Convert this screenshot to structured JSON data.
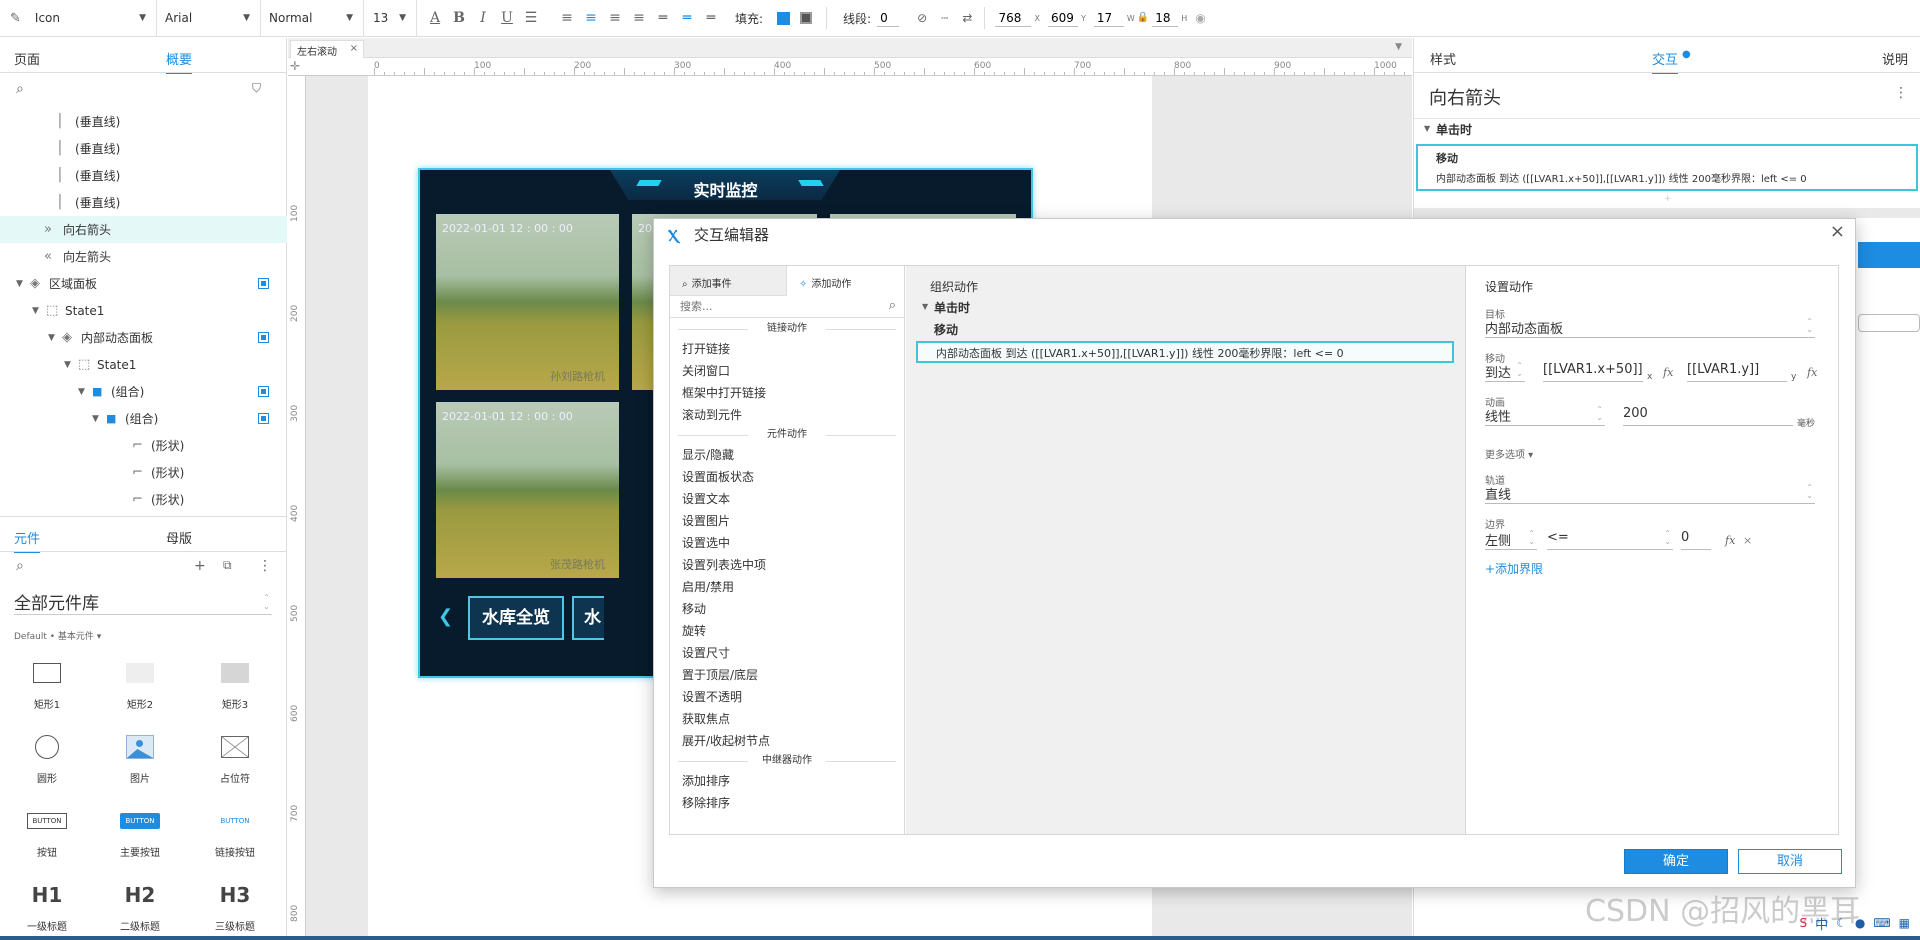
{
  "toolbar": {
    "style_select": "Icon",
    "font_select": "Arial",
    "weight_select": "Normal",
    "size_select": "13",
    "fill_label": "填充:",
    "line_label": "线段:",
    "line_value": "0",
    "x": "768",
    "x_label": "X",
    "y": "609",
    "y_label": "Y",
    "w": "17",
    "w_label": "W",
    "h": "18",
    "h_label": "H",
    "fill_color": "#1e8ce0"
  },
  "left": {
    "tab_pages": "页面",
    "tab_outline": "概要",
    "outline": [
      {
        "label": "(垂直线)",
        "indent": 56,
        "icon": "line"
      },
      {
        "label": "(垂直线)",
        "indent": 56,
        "icon": "line"
      },
      {
        "label": "(垂直线)",
        "indent": 56,
        "icon": "line"
      },
      {
        "label": "(垂直线)",
        "indent": 56,
        "icon": "line"
      },
      {
        "label": "向右箭头",
        "indent": 44,
        "icon": "chev-right",
        "selected": true
      },
      {
        "label": "向左箭头",
        "indent": 44,
        "icon": "chev-left"
      },
      {
        "label": "区域面板",
        "indent": 30,
        "icon": "stack",
        "arrow": true,
        "check": true
      },
      {
        "label": "State1",
        "indent": 46,
        "icon": "state",
        "arrow": true
      },
      {
        "label": "内部动态面板",
        "indent": 62,
        "icon": "stack",
        "arrow": true,
        "check": true
      },
      {
        "label": "State1",
        "indent": 78,
        "icon": "state",
        "arrow": true
      },
      {
        "label": "(组合)",
        "indent": 92,
        "icon": "folder",
        "arrow": true,
        "check": true
      },
      {
        "label": "(组合)",
        "indent": 106,
        "icon": "folder",
        "arrow": true,
        "check": true
      },
      {
        "label": "(形状)",
        "indent": 132,
        "icon": "shape"
      },
      {
        "label": "(形状)",
        "indent": 132,
        "icon": "shape"
      },
      {
        "label": "(形状)",
        "indent": 132,
        "icon": "shape"
      }
    ],
    "tab_widgets": "元件",
    "tab_masters": "母版",
    "library_select": "全部元件库",
    "library_sub": "Default • 基本元件 ▾",
    "widgets": [
      {
        "label": "矩形1",
        "kind": "rect1"
      },
      {
        "label": "矩形2",
        "kind": "rect2"
      },
      {
        "label": "矩形3",
        "kind": "rect3"
      },
      {
        "label": "圆形",
        "kind": "circle"
      },
      {
        "label": "图片",
        "kind": "image"
      },
      {
        "label": "占位符",
        "kind": "placeholder"
      },
      {
        "label": "按钮",
        "kind": "button",
        "text": "BUTTON"
      },
      {
        "label": "主要按钮",
        "kind": "primary",
        "text": "BUTTON"
      },
      {
        "label": "链接按钮",
        "kind": "link",
        "text": "BUTTON"
      },
      {
        "label": "一级标题",
        "kind": "h",
        "text": "H1"
      },
      {
        "label": "二级标题",
        "kind": "h",
        "text": "H2"
      },
      {
        "label": "三级标题",
        "kind": "h",
        "text": "H3"
      }
    ]
  },
  "canvas": {
    "tab": "左右滚动",
    "ruler_h": [
      "0",
      "100",
      "200",
      "300",
      "400",
      "500",
      "600",
      "700",
      "800",
      "900",
      "1000"
    ],
    "ruler_v": [
      "100",
      "200",
      "300",
      "400",
      "500",
      "600",
      "700",
      "800"
    ],
    "monitor_title": "实时监控",
    "timestamp": "2022-01-01  12 : 00 : 00",
    "cam_labels": [
      "孙刘路枪机",
      "张茂路枪机"
    ],
    "btn1": "水库全览",
    "btn2": "水"
  },
  "right": {
    "tab_style": "样式",
    "tab_interact": "交互",
    "tab_notes": "说明",
    "title": "向右箭头",
    "event": "单击时",
    "action_title": "移动",
    "action_desc": "内部动态面板 到达 ([[LVAR1.x+50]],[[LVAR1.y]]) 线性 200毫秒界限：left <= 0"
  },
  "dialog": {
    "title": "交互编辑器",
    "tab_add_event": "添加事件",
    "tab_add_action": "添加动作",
    "search_placeholder": "搜索...",
    "groups": [
      {
        "title": "链接动作",
        "items": [
          "打开链接",
          "关闭窗口",
          "框架中打开链接",
          "滚动到元件"
        ]
      },
      {
        "title": "元件动作",
        "items": [
          "显示/隐藏",
          "设置面板状态",
          "设置文本",
          "设置图片",
          "设置选中",
          "设置列表选中项",
          "启用/禁用",
          "移动",
          "旋转",
          "设置尺寸",
          "置于顶层/底层",
          "设置不透明",
          "获取焦点",
          "展开/收起树节点"
        ]
      },
      {
        "title": "中继器动作",
        "items": [
          "添加排序",
          "移除排序"
        ]
      }
    ],
    "organize_title": "组织动作",
    "event": "单击时",
    "action_title": "移动",
    "action_desc": "内部动态面板 到达 ([[LVAR1.x+50]],[[LVAR1.y]]) 线性 200毫秒界限：left <= 0",
    "settings_title": "设置动作",
    "target_label": "目标",
    "target_value": "内部动态面板",
    "move_label": "移动",
    "move_type": "到达",
    "move_x": "[[LVAR1.x+50]]",
    "move_y": "[[LVAR1.y]]",
    "x_sub": "x",
    "y_sub": "y",
    "anim_label": "动画",
    "anim_value": "线性",
    "anim_ms": "200",
    "ms_unit": "毫秒",
    "more_options": "更多选项 ▾",
    "track_label": "轨道",
    "track_value": "直线",
    "bound_label": "边界",
    "bound_side": "左侧",
    "bound_op": "<=",
    "bound_value": "0",
    "add_bound": "+添加界限",
    "ok": "确定",
    "cancel": "取消"
  },
  "watermark": "CSDN @招风的黑耳",
  "ime": "中"
}
